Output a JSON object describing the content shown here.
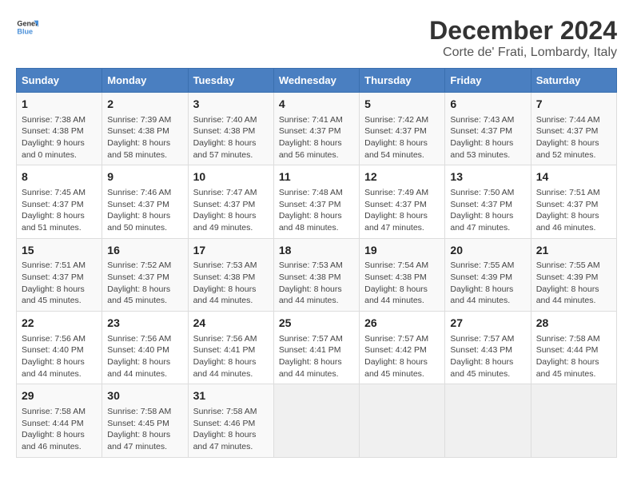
{
  "logo": {
    "line1": "General",
    "line2": "Blue"
  },
  "title": "December 2024",
  "subtitle": "Corte de' Frati, Lombardy, Italy",
  "weekdays": [
    "Sunday",
    "Monday",
    "Tuesday",
    "Wednesday",
    "Thursday",
    "Friday",
    "Saturday"
  ],
  "weeks": [
    [
      {
        "day": "1",
        "info": "Sunrise: 7:38 AM\nSunset: 4:38 PM\nDaylight: 9 hours\nand 0 minutes."
      },
      {
        "day": "2",
        "info": "Sunrise: 7:39 AM\nSunset: 4:38 PM\nDaylight: 8 hours\nand 58 minutes."
      },
      {
        "day": "3",
        "info": "Sunrise: 7:40 AM\nSunset: 4:38 PM\nDaylight: 8 hours\nand 57 minutes."
      },
      {
        "day": "4",
        "info": "Sunrise: 7:41 AM\nSunset: 4:37 PM\nDaylight: 8 hours\nand 56 minutes."
      },
      {
        "day": "5",
        "info": "Sunrise: 7:42 AM\nSunset: 4:37 PM\nDaylight: 8 hours\nand 54 minutes."
      },
      {
        "day": "6",
        "info": "Sunrise: 7:43 AM\nSunset: 4:37 PM\nDaylight: 8 hours\nand 53 minutes."
      },
      {
        "day": "7",
        "info": "Sunrise: 7:44 AM\nSunset: 4:37 PM\nDaylight: 8 hours\nand 52 minutes."
      }
    ],
    [
      {
        "day": "8",
        "info": "Sunrise: 7:45 AM\nSunset: 4:37 PM\nDaylight: 8 hours\nand 51 minutes."
      },
      {
        "day": "9",
        "info": "Sunrise: 7:46 AM\nSunset: 4:37 PM\nDaylight: 8 hours\nand 50 minutes."
      },
      {
        "day": "10",
        "info": "Sunrise: 7:47 AM\nSunset: 4:37 PM\nDaylight: 8 hours\nand 49 minutes."
      },
      {
        "day": "11",
        "info": "Sunrise: 7:48 AM\nSunset: 4:37 PM\nDaylight: 8 hours\nand 48 minutes."
      },
      {
        "day": "12",
        "info": "Sunrise: 7:49 AM\nSunset: 4:37 PM\nDaylight: 8 hours\nand 47 minutes."
      },
      {
        "day": "13",
        "info": "Sunrise: 7:50 AM\nSunset: 4:37 PM\nDaylight: 8 hours\nand 47 minutes."
      },
      {
        "day": "14",
        "info": "Sunrise: 7:51 AM\nSunset: 4:37 PM\nDaylight: 8 hours\nand 46 minutes."
      }
    ],
    [
      {
        "day": "15",
        "info": "Sunrise: 7:51 AM\nSunset: 4:37 PM\nDaylight: 8 hours\nand 45 minutes."
      },
      {
        "day": "16",
        "info": "Sunrise: 7:52 AM\nSunset: 4:37 PM\nDaylight: 8 hours\nand 45 minutes."
      },
      {
        "day": "17",
        "info": "Sunrise: 7:53 AM\nSunset: 4:38 PM\nDaylight: 8 hours\nand 44 minutes."
      },
      {
        "day": "18",
        "info": "Sunrise: 7:53 AM\nSunset: 4:38 PM\nDaylight: 8 hours\nand 44 minutes."
      },
      {
        "day": "19",
        "info": "Sunrise: 7:54 AM\nSunset: 4:38 PM\nDaylight: 8 hours\nand 44 minutes."
      },
      {
        "day": "20",
        "info": "Sunrise: 7:55 AM\nSunset: 4:39 PM\nDaylight: 8 hours\nand 44 minutes."
      },
      {
        "day": "21",
        "info": "Sunrise: 7:55 AM\nSunset: 4:39 PM\nDaylight: 8 hours\nand 44 minutes."
      }
    ],
    [
      {
        "day": "22",
        "info": "Sunrise: 7:56 AM\nSunset: 4:40 PM\nDaylight: 8 hours\nand 44 minutes."
      },
      {
        "day": "23",
        "info": "Sunrise: 7:56 AM\nSunset: 4:40 PM\nDaylight: 8 hours\nand 44 minutes."
      },
      {
        "day": "24",
        "info": "Sunrise: 7:56 AM\nSunset: 4:41 PM\nDaylight: 8 hours\nand 44 minutes."
      },
      {
        "day": "25",
        "info": "Sunrise: 7:57 AM\nSunset: 4:41 PM\nDaylight: 8 hours\nand 44 minutes."
      },
      {
        "day": "26",
        "info": "Sunrise: 7:57 AM\nSunset: 4:42 PM\nDaylight: 8 hours\nand 45 minutes."
      },
      {
        "day": "27",
        "info": "Sunrise: 7:57 AM\nSunset: 4:43 PM\nDaylight: 8 hours\nand 45 minutes."
      },
      {
        "day": "28",
        "info": "Sunrise: 7:58 AM\nSunset: 4:44 PM\nDaylight: 8 hours\nand 45 minutes."
      }
    ],
    [
      {
        "day": "29",
        "info": "Sunrise: 7:58 AM\nSunset: 4:44 PM\nDaylight: 8 hours\nand 46 minutes."
      },
      {
        "day": "30",
        "info": "Sunrise: 7:58 AM\nSunset: 4:45 PM\nDaylight: 8 hours\nand 47 minutes."
      },
      {
        "day": "31",
        "info": "Sunrise: 7:58 AM\nSunset: 4:46 PM\nDaylight: 8 hours\nand 47 minutes."
      },
      {
        "day": "",
        "info": ""
      },
      {
        "day": "",
        "info": ""
      },
      {
        "day": "",
        "info": ""
      },
      {
        "day": "",
        "info": ""
      }
    ]
  ]
}
